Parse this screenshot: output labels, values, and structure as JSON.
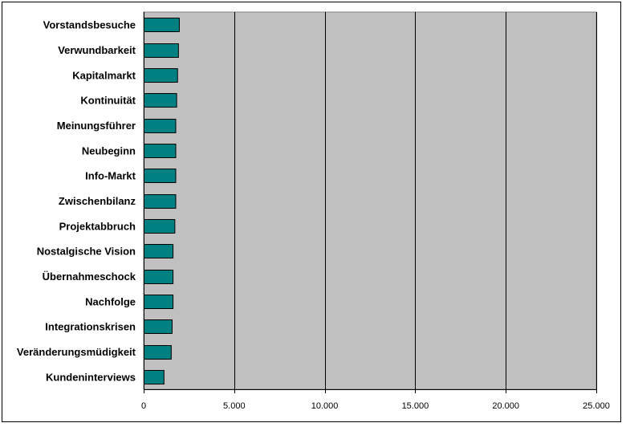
{
  "chart_data": {
    "type": "bar",
    "orientation": "horizontal",
    "title": "",
    "xlabel": "",
    "ylabel": "",
    "categories": [
      "Vorstandsbesuche",
      "Verwundbarkeit",
      "Kapitalmarkt",
      "Kontinuität",
      "Meinungsführer",
      "Neubeginn",
      "Info-Markt",
      "Zwischenbilanz",
      "Projektabbruch",
      "Nostalgische Vision",
      "Übernahmeschock",
      "Nachfolge",
      "Integrationskrisen",
      "Veränderungsmüdigkeit",
      "Kundeninterviews"
    ],
    "values": [
      1950,
      1900,
      1850,
      1800,
      1750,
      1750,
      1750,
      1750,
      1700,
      1600,
      1600,
      1600,
      1550,
      1500,
      1100
    ],
    "xlim": [
      0,
      25000
    ],
    "ticks": [
      0,
      5000,
      10000,
      15000,
      20000,
      25000
    ],
    "tick_labels": [
      "0",
      "5.000",
      "10.000",
      "15.000",
      "20.000",
      "25.000"
    ],
    "grid": true,
    "colors": {
      "bar": "#008080",
      "plot_background": "#c0c0c0",
      "gridline": "#000000"
    }
  }
}
